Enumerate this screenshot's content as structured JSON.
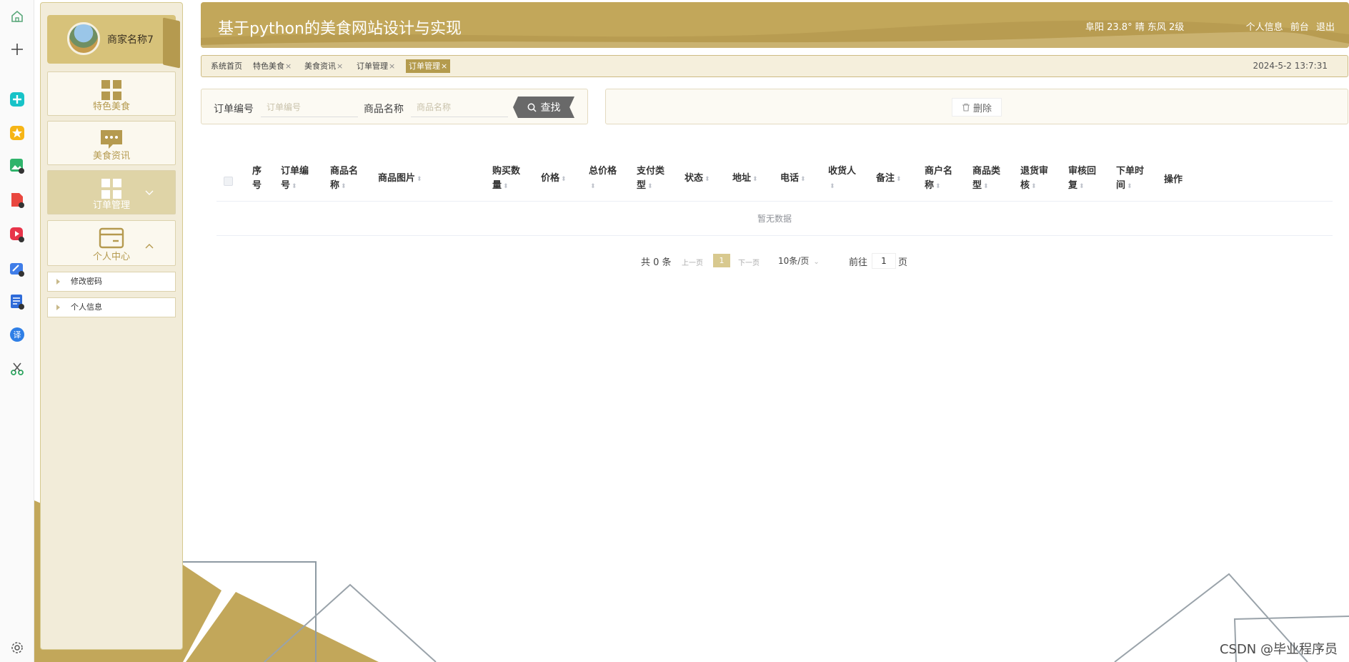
{
  "app": {
    "title": "基于python的美食网站设计与实现",
    "weather": "阜阳 23.8° 晴 东风 2级",
    "header_links": [
      "个人信息",
      "前台",
      "退出"
    ]
  },
  "sidebar": {
    "profile_name": "商家名称7",
    "menu": [
      {
        "label": "特色美食",
        "icon": "grid-icon"
      },
      {
        "label": "美食资讯",
        "icon": "chat-bubble-icon"
      },
      {
        "label": "订单管理",
        "icon": "grid-icon",
        "active": true
      },
      {
        "label": "个人中心",
        "icon": "card-icon"
      }
    ],
    "submenu": [
      "修改密码",
      "个人信息"
    ]
  },
  "tabs": [
    {
      "label": "系统首页",
      "closable": false
    },
    {
      "label": "特色美食",
      "closable": true
    },
    {
      "label": "美食资讯",
      "closable": true
    },
    {
      "label": "订单管理",
      "closable": true
    },
    {
      "label": "订单管理",
      "closable": true,
      "active": true
    }
  ],
  "tabs_close_glyph": "×",
  "datetime": "2024-5-2 13:7:31",
  "search": {
    "order_no_label": "订单编号",
    "order_no_placeholder": "订单编号",
    "product_name_label": "商品名称",
    "product_name_placeholder": "商品名称",
    "search_button": "查找"
  },
  "actions": {
    "delete_button": "删除"
  },
  "table": {
    "columns": [
      {
        "line1": "序",
        "line2": "号",
        "sortable": false
      },
      {
        "line1": "订单编",
        "line2": "号",
        "sortable": true
      },
      {
        "line1": "商品名",
        "line2": "称",
        "sortable": true
      },
      {
        "line1": "商品图片",
        "line2": "",
        "sortable": true
      },
      {
        "line1": "购买数",
        "line2": "量",
        "sortable": true
      },
      {
        "line1": "价格",
        "line2": "",
        "sortable": true
      },
      {
        "line1": "总价格",
        "line2": "",
        "sortable": true
      },
      {
        "line1": "支付类",
        "line2": "型",
        "sortable": true
      },
      {
        "line1": "状态",
        "line2": "",
        "sortable": true
      },
      {
        "line1": "地址",
        "line2": "",
        "sortable": true
      },
      {
        "line1": "电话",
        "line2": "",
        "sortable": true
      },
      {
        "line1": "收货人",
        "line2": "",
        "sortable": true
      },
      {
        "line1": "备注",
        "line2": "",
        "sortable": true
      },
      {
        "line1": "商户名",
        "line2": "称",
        "sortable": true
      },
      {
        "line1": "商品类",
        "line2": "型",
        "sortable": true
      },
      {
        "line1": "退货审",
        "line2": "核",
        "sortable": true
      },
      {
        "line1": "审核回",
        "line2": "复",
        "sortable": true
      },
      {
        "line1": "下单时",
        "line2": "间",
        "sortable": true
      },
      {
        "line1": "操作",
        "line2": "",
        "sortable": false
      }
    ],
    "empty_text": "暂无数据"
  },
  "pagination": {
    "total": "共 0 条",
    "prev": "上一页",
    "current": "1",
    "next": "下一页",
    "page_size": "10条/页",
    "goto_label": "前往",
    "goto_value": "1",
    "page_unit": "页"
  },
  "watermark": "CSDN @毕业程序员",
  "colors": {
    "accent": "#c2a75a",
    "accent_dark": "#b49b4d",
    "sidebar_bg": "#f2ecd9",
    "button_gray": "#696969"
  }
}
